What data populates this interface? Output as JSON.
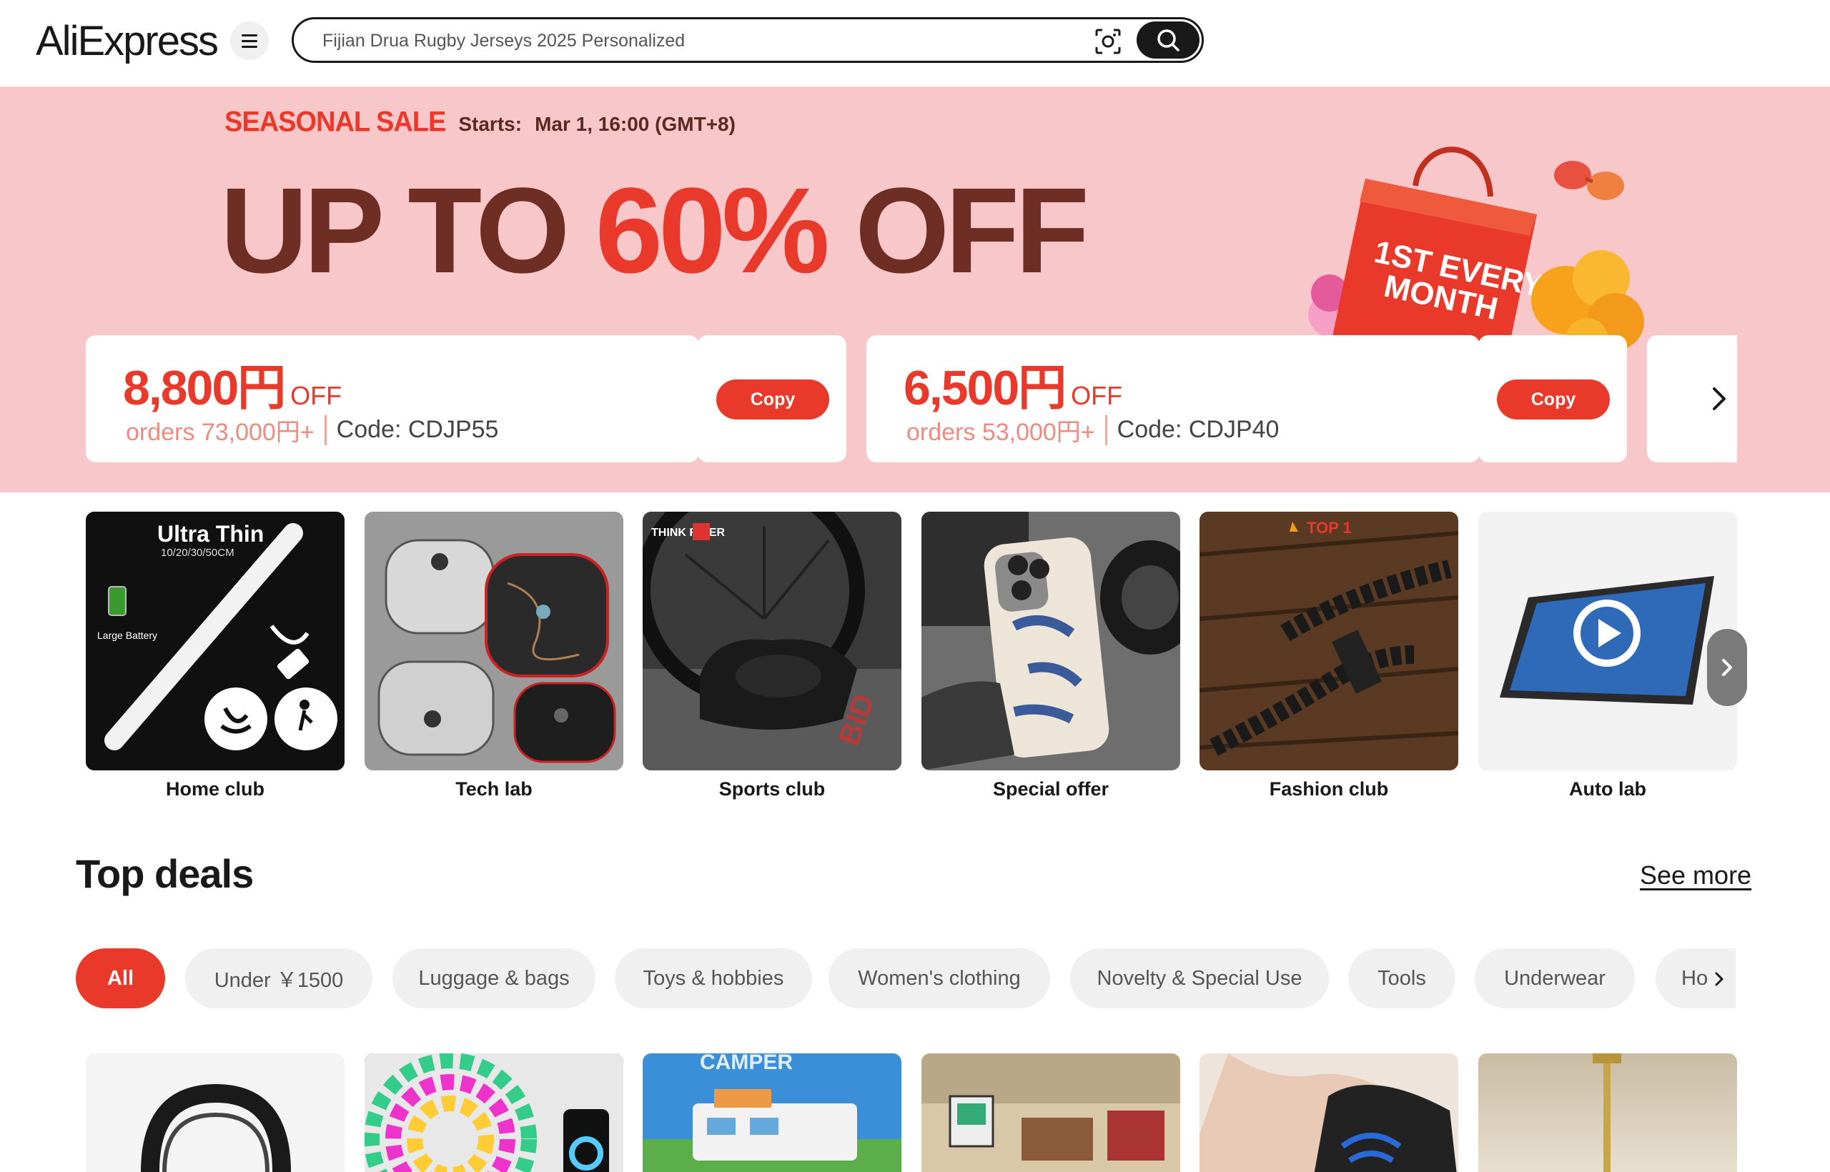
{
  "header": {
    "logo_text": "AliExpress",
    "search_value": "Fijian Drua Rugby Jerseys 2025 Personalized"
  },
  "banner": {
    "sale_tag": "SEASONAL SALE",
    "starts_label": "Starts:",
    "starts_value": "Mar 1, 16:00 (GMT+8)",
    "headline_pre": "UP TO ",
    "headline_pct": "60%",
    "headline_post": " OFF",
    "bag_text": "1ST EVERY MONTH",
    "coupons": [
      {
        "amount": "8,800円",
        "off": "OFF",
        "min_order": "orders 73,000円+",
        "code": "Code: CDJP55",
        "copy_label": "Copy"
      },
      {
        "amount": "6,500円",
        "off": "OFF",
        "min_order": "orders 53,000円+",
        "code": "Code: CDJP40",
        "copy_label": "Copy"
      }
    ]
  },
  "clubs": [
    {
      "label": "Home club",
      "img_text": "Ultra Thin",
      "img_sub": "10/20/30/50CM",
      "img_note": "Large Battery"
    },
    {
      "label": "Tech lab"
    },
    {
      "label": "Sports club",
      "img_text": "THINK RIDER"
    },
    {
      "label": "Special offer"
    },
    {
      "label": "Fashion club",
      "img_text": "TOP 1"
    },
    {
      "label": "Auto lab"
    }
  ],
  "top_deals": {
    "title": "Top deals",
    "see_more": "See more",
    "chips": [
      "All",
      "Under ￥1500",
      "Luggage & bags",
      "Toys & hobbies",
      "Women's clothing",
      "Novelty & Special Use",
      "Tools",
      "Underwear",
      "Ho"
    ]
  },
  "colors": {
    "accent": "#e8392b",
    "banner_bg": "#f7c7c9",
    "headline": "#6e2e24",
    "chip_bg": "#f0f0f0"
  }
}
